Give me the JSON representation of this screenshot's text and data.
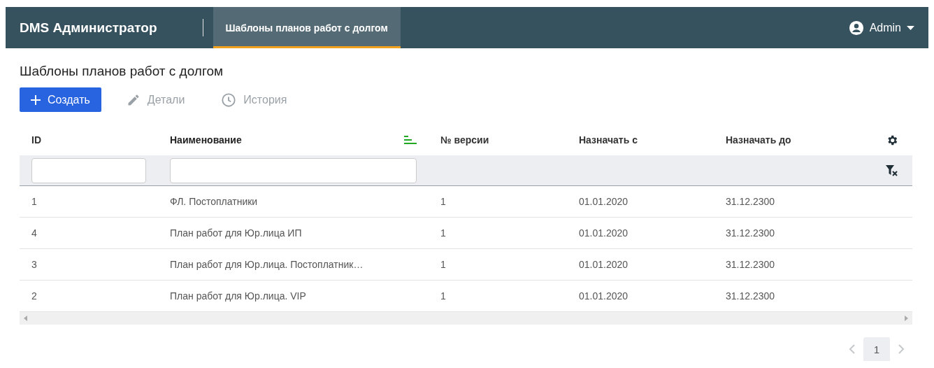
{
  "header": {
    "app_title": "DMS Администратор",
    "tabs": [
      {
        "label": "Шаблоны планов работ с долгом",
        "selected": true
      }
    ],
    "user": {
      "name": "Admin"
    }
  },
  "page_title": "Шаблоны планов работ с долгом",
  "toolbar": [
    {
      "kind": "create",
      "label": "Создать",
      "disabled": false
    },
    {
      "kind": "details",
      "label": "Детали",
      "disabled": true
    },
    {
      "kind": "history",
      "label": "История",
      "disabled": true
    }
  ],
  "table": {
    "columns": [
      {
        "label": "ID",
        "filter": true,
        "sorted": false
      },
      {
        "label": "Наименование",
        "filter": true,
        "sorted": true
      },
      {
        "label": "№ версии",
        "filter": false,
        "sorted": false
      },
      {
        "label": "Назначать с",
        "filter": false,
        "sorted": false
      },
      {
        "label": "Назначать до",
        "filter": false,
        "sorted": false
      }
    ],
    "rows": [
      [
        "1",
        "ФЛ. Постоплатники",
        "1",
        "01.01.2020",
        "31.12.2300"
      ],
      [
        "4",
        "План работ для Юр.лица ИП",
        "1",
        "01.01.2020",
        "31.12.2300"
      ],
      [
        "3",
        "План работ для Юр.лица. Постоплатник…",
        "1",
        "01.01.2020",
        "31.12.2300"
      ],
      [
        "2",
        "План работ для Юр.лица. VIP",
        "1",
        "01.01.2020",
        "31.12.2300"
      ]
    ]
  },
  "pagination": {
    "prev_disabled": true,
    "next_disabled": true,
    "pages": [
      {
        "label": "1",
        "selected": true
      }
    ]
  }
}
